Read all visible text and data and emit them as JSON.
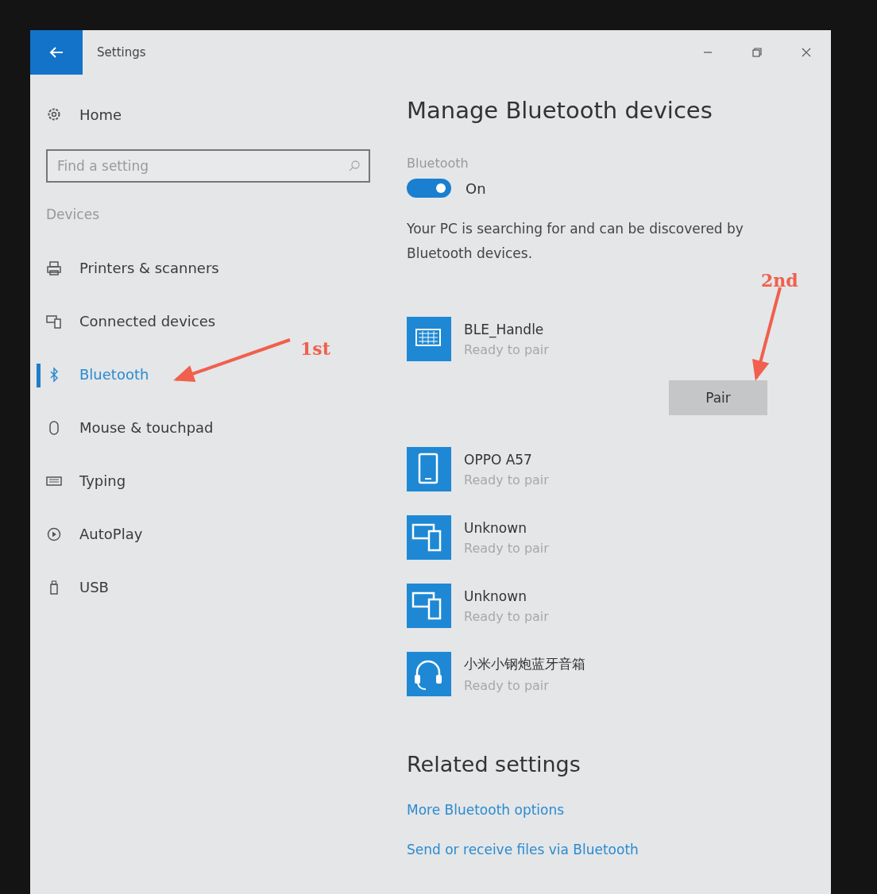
{
  "window": {
    "title": "Settings"
  },
  "sidebar": {
    "home": "Home",
    "search": {
      "placeholder": "Find a setting"
    },
    "section": "Devices",
    "items": [
      {
        "label": "Printers & scanners",
        "kind": "printer",
        "selected": false
      },
      {
        "label": "Connected devices",
        "kind": "devices",
        "selected": false
      },
      {
        "label": "Bluetooth",
        "kind": "bluetooth",
        "selected": true
      },
      {
        "label": "Mouse & touchpad",
        "kind": "mouse",
        "selected": false
      },
      {
        "label": "Typing",
        "kind": "keyboard",
        "selected": false
      },
      {
        "label": "AutoPlay",
        "kind": "autoplay",
        "selected": false
      },
      {
        "label": "USB",
        "kind": "usb",
        "selected": false
      }
    ]
  },
  "main": {
    "title": "Manage Bluetooth devices",
    "toggle_label": "Bluetooth",
    "toggle": {
      "on": true,
      "label": "On"
    },
    "description": "Your PC is searching for and can be discovered by Bluetooth devices.",
    "devices": [
      {
        "name": "BLE_Handle",
        "status": "Ready to pair",
        "kind": "keyboard",
        "action": "Pair"
      },
      {
        "name": "OPPO A57",
        "status": "Ready to pair",
        "kind": "phone"
      },
      {
        "name": "Unknown",
        "status": "Ready to pair",
        "kind": "devices"
      },
      {
        "name": "Unknown",
        "status": "Ready to pair",
        "kind": "devices"
      },
      {
        "name": "小米小钢炮蓝牙音箱",
        "status": "Ready to pair",
        "kind": "headset"
      }
    ],
    "related_title": "Related settings",
    "links": [
      "More Bluetooth options",
      "Send or receive files via Bluetooth"
    ]
  },
  "annotations": [
    {
      "text": "1st",
      "kind": "left"
    },
    {
      "text": "2nd",
      "kind": "down"
    }
  ]
}
